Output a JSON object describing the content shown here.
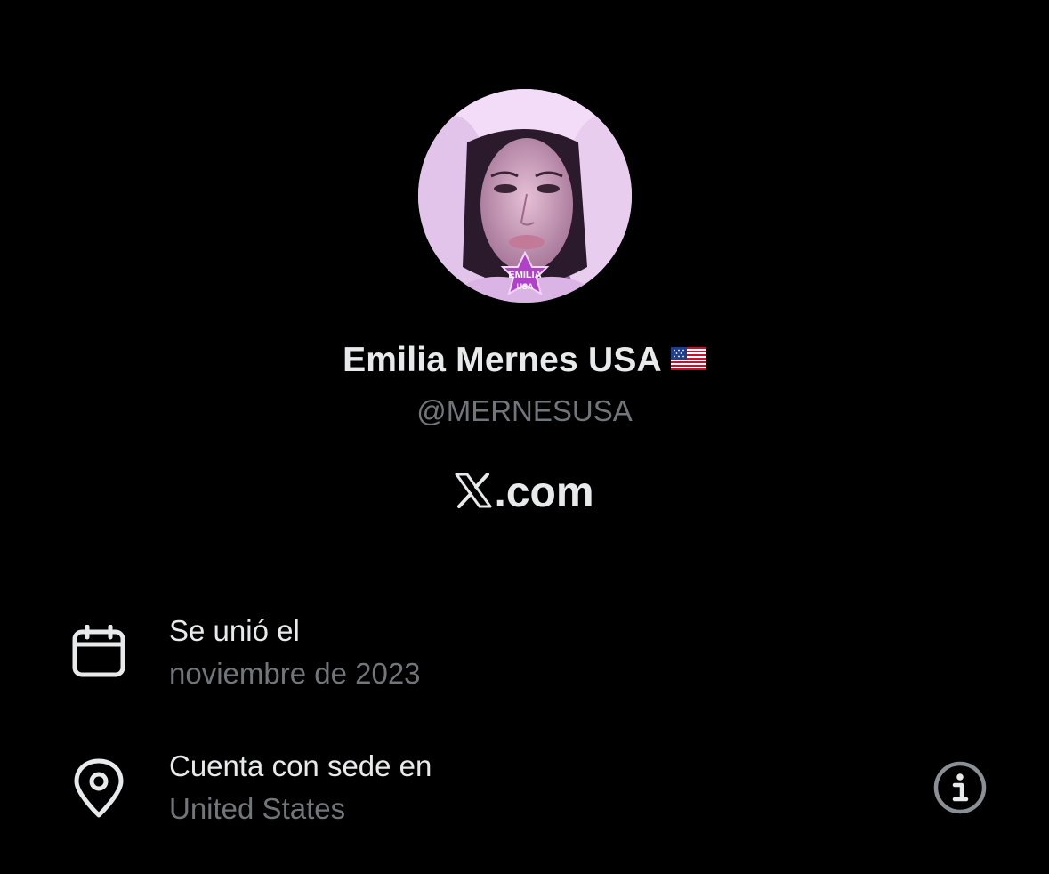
{
  "profile": {
    "display_name": "Emilia Mernes USA",
    "flag_emoji": "🇺🇸",
    "handle": "@MERNESUSA",
    "avatar_badge_text": "EMILIA USA"
  },
  "brand": {
    "site_text": ".com",
    "logo_icon": "x-logo-icon"
  },
  "info": {
    "joined": {
      "icon": "calendar-icon",
      "title": "Se unió el",
      "value": "noviembre de 2023"
    },
    "location": {
      "icon": "location-pin-icon",
      "title": "Cuenta con sede en",
      "value": "United States",
      "action_icon": "info-icon"
    }
  },
  "colors": {
    "background": "#000000",
    "primary_text": "#e7e9ea",
    "secondary_text": "#71767b",
    "avatar_tint": "#c9a6d8"
  }
}
